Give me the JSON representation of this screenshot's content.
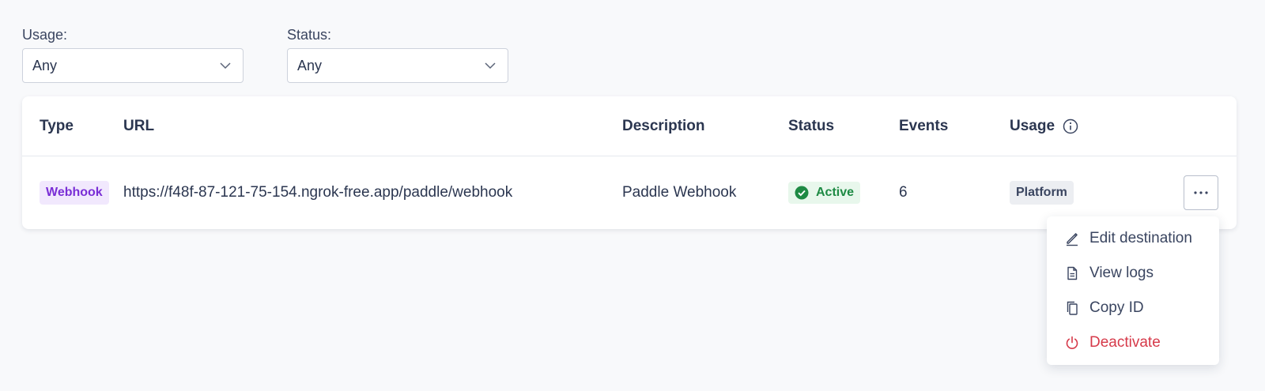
{
  "filters": {
    "usage": {
      "label": "Usage:",
      "value": "Any"
    },
    "status": {
      "label": "Status:",
      "value": "Any"
    }
  },
  "table": {
    "columns": {
      "type": "Type",
      "url": "URL",
      "description": "Description",
      "status": "Status",
      "events": "Events",
      "usage": "Usage"
    },
    "rows": [
      {
        "type": "Webhook",
        "url": "https://f48f-87-121-75-154.ngrok-free.app/paddle/webhook",
        "description": "Paddle Webhook",
        "status": "Active",
        "events": "6",
        "usage": "Platform"
      }
    ]
  },
  "menu": {
    "items": [
      {
        "label": "Edit destination",
        "icon": "pencil-icon"
      },
      {
        "label": "View logs",
        "icon": "document-icon"
      },
      {
        "label": "Copy ID",
        "icon": "copy-icon"
      },
      {
        "label": "Deactivate",
        "icon": "power-icon"
      }
    ]
  },
  "colors": {
    "webhook_badge_bg": "#f1e8fd",
    "webhook_badge_text": "#7a2ed6",
    "active_badge_bg": "#e8f7ec",
    "active_badge_text": "#1e8a44",
    "danger": "#d63a4a"
  }
}
